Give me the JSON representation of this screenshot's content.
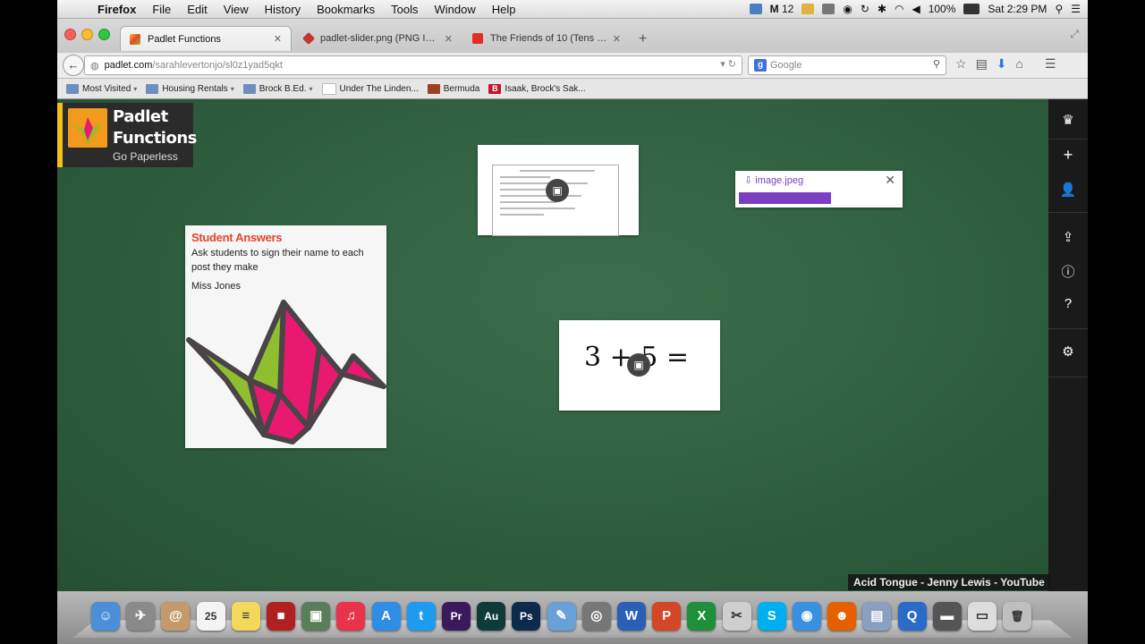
{
  "menubar": {
    "items": [
      "Firefox",
      "File",
      "Edit",
      "View",
      "History",
      "Bookmarks",
      "Tools",
      "Window",
      "Help"
    ],
    "status_count": "12",
    "battery": "100%",
    "clock": "Sat 2:29 PM"
  },
  "tabs": [
    {
      "label": "Padlet Functions",
      "favicon_color": "#e8442a"
    },
    {
      "label": "padlet-slider.png (PNG Im...",
      "favicon_color": "#c0392b"
    },
    {
      "label": "The Friends of 10 (Tens fr...",
      "favicon_color": "#e52d27"
    }
  ],
  "navbar": {
    "url_host": "padlet.com",
    "url_path": "/sarahlevertonjo/sl0z1yad5qkt",
    "search_placeholder": "Google"
  },
  "bookmarks": [
    {
      "label": "Most Visited",
      "has_caret": true,
      "icon_color": "#6d8fbf"
    },
    {
      "label": "Housing Rentals",
      "has_caret": true,
      "icon_color": "#6d8fbf"
    },
    {
      "label": "Brock B.Ed.",
      "has_caret": true,
      "icon_color": "#6d8fbf"
    },
    {
      "label": "Under The Linden...",
      "has_caret": false,
      "icon_color": "#ffffff"
    },
    {
      "label": "Bermuda",
      "has_caret": false,
      "icon_color": "#a04020"
    },
    {
      "label": "Isaak, Brock's Sak...",
      "has_caret": false,
      "icon_color": "#c0172c"
    }
  ],
  "padlet": {
    "logo_title_line1": "Padlet",
    "logo_title_line2": "Functions",
    "logo_subtitle": "Go Paperless",
    "upload": {
      "filename": "image.jpeg",
      "progress": 0.55
    },
    "answer_post": {
      "title": "Student Answers",
      "body": "Ask students to sign their name to each post they make",
      "signature": "Miss Jones"
    },
    "math_post": {
      "equation": "3 + 5 ="
    }
  },
  "video_overlay": "Acid Tongue - Jenny Lewis - YouTube",
  "dock": [
    {
      "name": "finder-icon",
      "color": "#4a8fd8",
      "glyph": "☺"
    },
    {
      "name": "launchpad-icon",
      "color": "#8a8a8a",
      "glyph": "✈"
    },
    {
      "name": "contacts-icon",
      "color": "#c49a6c",
      "glyph": "@"
    },
    {
      "name": "calendar-icon",
      "color": "#f4f4f4",
      "glyph": "25"
    },
    {
      "name": "notes-icon",
      "color": "#f2d95c",
      "glyph": "≡"
    },
    {
      "name": "photobooth-icon",
      "color": "#b02020",
      "glyph": "■"
    },
    {
      "name": "preview-icon",
      "color": "#5a7d5a",
      "glyph": "▣"
    },
    {
      "name": "itunes-icon",
      "color": "#e8334a",
      "glyph": "♫"
    },
    {
      "name": "appstore-icon",
      "color": "#2f8de4",
      "glyph": "A"
    },
    {
      "name": "twitter-icon",
      "color": "#1d9bf0",
      "glyph": "t"
    },
    {
      "name": "premiere-icon",
      "color": "#3a1a5a",
      "glyph": "Pr"
    },
    {
      "name": "audition-icon",
      "color": "#0e3a3a",
      "glyph": "Au"
    },
    {
      "name": "photoshop-icon",
      "color": "#0d2a4a",
      "glyph": "Ps"
    },
    {
      "name": "textedit-icon",
      "color": "#6aa0d8",
      "glyph": "✎"
    },
    {
      "name": "screenshot-icon",
      "color": "#777777",
      "glyph": "◎"
    },
    {
      "name": "word-icon",
      "color": "#2b5fb3",
      "glyph": "W"
    },
    {
      "name": "powerpoint-icon",
      "color": "#d24726",
      "glyph": "P"
    },
    {
      "name": "excel-icon",
      "color": "#1f8f3a",
      "glyph": "X"
    },
    {
      "name": "script-icon",
      "color": "#cfcfcf",
      "glyph": "✂"
    },
    {
      "name": "skype-icon",
      "color": "#00aff0",
      "glyph": "S"
    },
    {
      "name": "safari-icon",
      "color": "#3a8fe0",
      "glyph": "◉"
    },
    {
      "name": "firefox-icon",
      "color": "#e66000",
      "glyph": "☻"
    },
    {
      "name": "iphoto-icon",
      "color": "#8aa0c0",
      "glyph": "▤"
    },
    {
      "name": "quicktime-icon",
      "color": "#2a6ac8",
      "glyph": "Q"
    },
    {
      "name": "downloads-icon",
      "color": "#555555",
      "glyph": "▬"
    },
    {
      "name": "display-icon",
      "color": "#dddddd",
      "glyph": "▭"
    },
    {
      "name": "trash-icon",
      "color": "#bfbfbf",
      "glyph": "🗑"
    }
  ]
}
